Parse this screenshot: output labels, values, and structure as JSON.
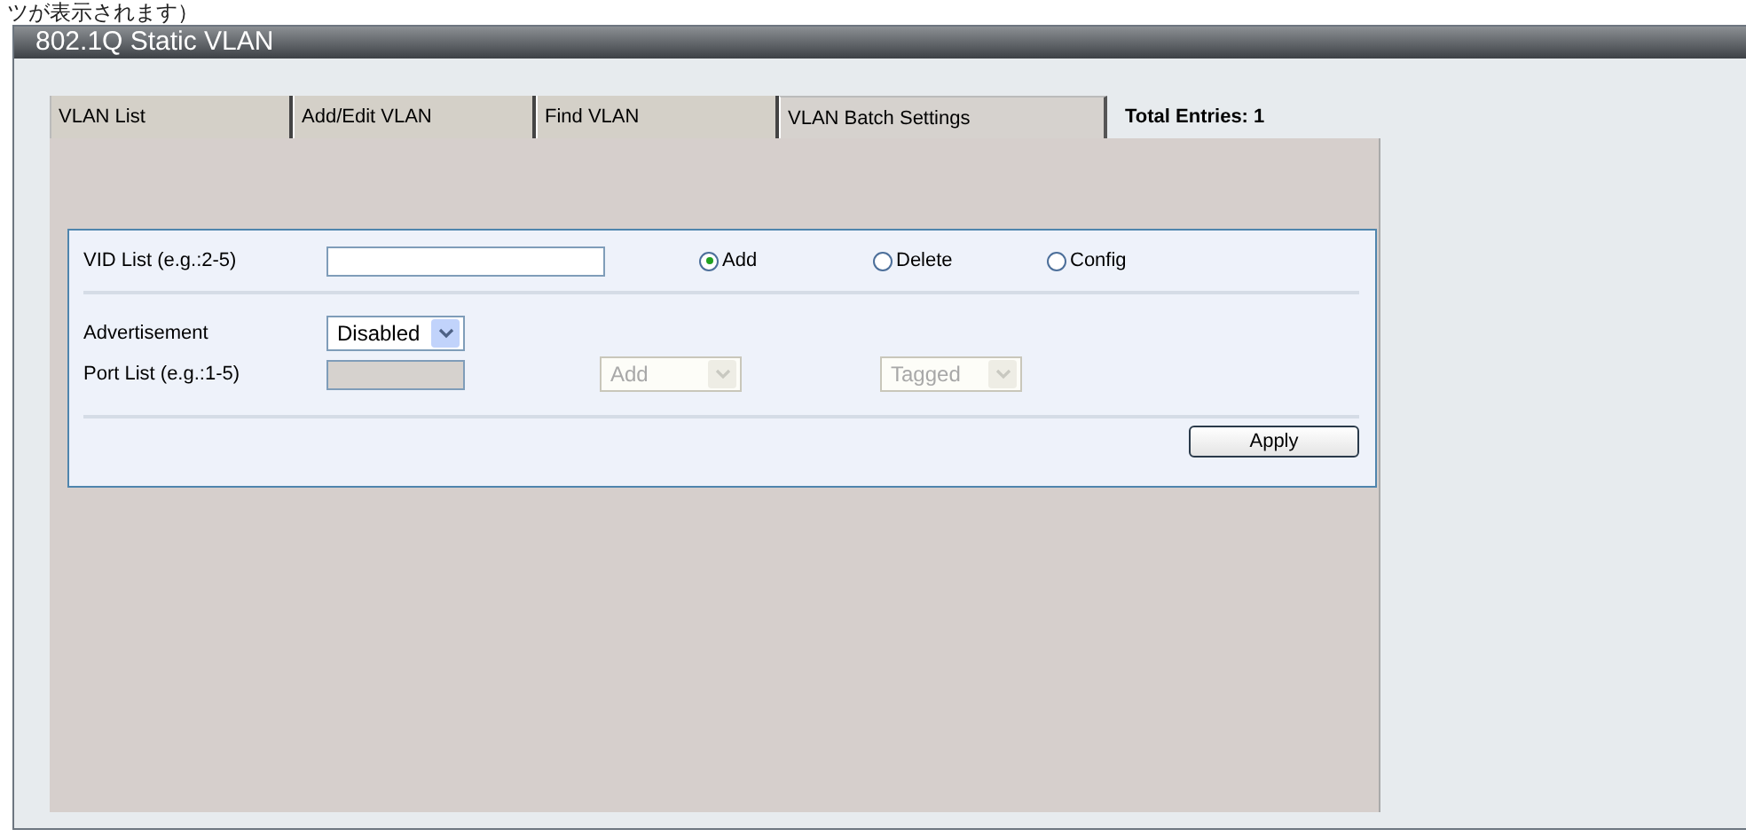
{
  "caption": "ツが表示されます）",
  "window": {
    "title": "802.1Q Static VLAN"
  },
  "tabs": [
    {
      "label": "VLAN List",
      "selected": false
    },
    {
      "label": "Add/Edit VLAN",
      "selected": false
    },
    {
      "label": "Find VLAN",
      "selected": false
    },
    {
      "label": "VLAN Batch Settings",
      "selected": true
    }
  ],
  "total_entries": "Total Entries: 1",
  "vid_list": {
    "label": "VID List (e.g.:2-5)"
  },
  "actions": [
    {
      "label": "Add",
      "selected": true
    },
    {
      "label": "Delete",
      "selected": false
    },
    {
      "label": "Config",
      "selected": false
    }
  ],
  "advertisement": {
    "label": "Advertisement",
    "value": "Disabled",
    "disabled": false
  },
  "port_list": {
    "label": "Port List (e.g.:1-5)",
    "disabled": true,
    "action": {
      "value": "Add",
      "disabled": true
    },
    "tagging": {
      "value": "Tagged",
      "disabled": true
    }
  },
  "apply_button": "Apply"
}
